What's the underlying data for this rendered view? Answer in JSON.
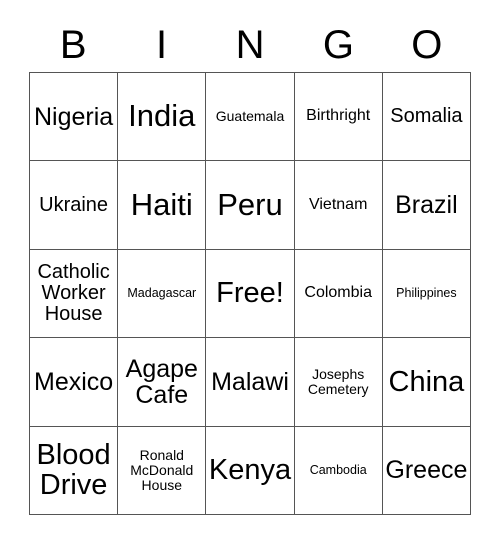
{
  "card": {
    "title": "BINGO",
    "headers": [
      "B",
      "I",
      "N",
      "G",
      "O"
    ],
    "free_space_label": "Free!",
    "colors": {
      "background": "#ffffff",
      "text": "#000000",
      "border": "#555555"
    },
    "rows": [
      [
        {
          "text": "Nigeria",
          "size": "l"
        },
        {
          "text": "India",
          "size": "xxl"
        },
        {
          "text": "Guatemala",
          "size": "xs"
        },
        {
          "text": "Birthright",
          "size": "s"
        },
        {
          "text": "Somalia",
          "size": "m"
        }
      ],
      [
        {
          "text": "Ukraine",
          "size": "m"
        },
        {
          "text": "Haiti",
          "size": "xxl"
        },
        {
          "text": "Peru",
          "size": "xxl"
        },
        {
          "text": "Vietnam",
          "size": "s"
        },
        {
          "text": "Brazil",
          "size": "l"
        }
      ],
      [
        {
          "text": "Catholic\nWorker\nHouse",
          "size": "m"
        },
        {
          "text": "Madagascar",
          "size": "xxs"
        },
        {
          "text": "Free!",
          "size": "xl"
        },
        {
          "text": "Colombia",
          "size": "s"
        },
        {
          "text": "Philippines",
          "size": "xxs"
        }
      ],
      [
        {
          "text": "Mexico",
          "size": "l"
        },
        {
          "text": "Agape\nCafe",
          "size": "l"
        },
        {
          "text": "Malawi",
          "size": "l"
        },
        {
          "text": "Josephs\nCemetery",
          "size": "xs"
        },
        {
          "text": "China",
          "size": "xl"
        }
      ],
      [
        {
          "text": "Blood\nDrive",
          "size": "xl"
        },
        {
          "text": "Ronald\nMcDonald\nHouse",
          "size": "xs"
        },
        {
          "text": "Kenya",
          "size": "xl"
        },
        {
          "text": "Cambodia",
          "size": "xxs"
        },
        {
          "text": "Greece",
          "size": "l"
        }
      ]
    ]
  }
}
